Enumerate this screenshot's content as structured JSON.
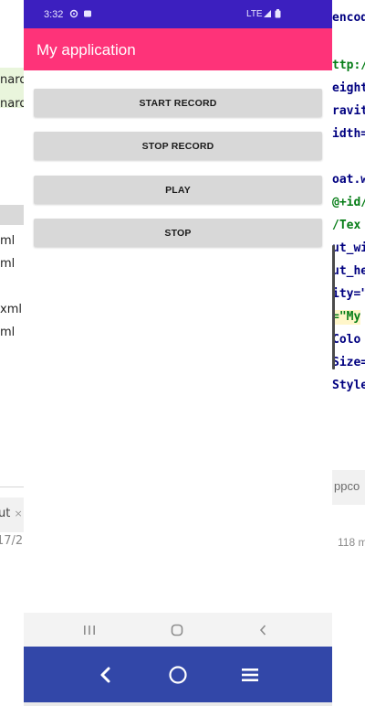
{
  "ide_left": {
    "files": [
      "nard",
      "nard",
      "ml",
      "ml",
      "xml",
      "ml"
    ],
    "tab_label": "ut",
    "tab_close": "×",
    "log_text": "17/2"
  },
  "ide_right": {
    "code_lines": [
      "encod",
      "ttp:/",
      "eight",
      "ravit",
      "idth=",
      "oat.w",
      "@+id/",
      "/Tex",
      "ut_wi",
      "ut_he",
      "ity=\"",
      "=\"My ",
      "Colo",
      "Size=",
      "Style"
    ],
    "tab_label": "ppco",
    "log_text": "118 m"
  },
  "status_bar": {
    "time": "3:32",
    "network": "LTE",
    "icons": [
      "gear-icon",
      "sim-icon",
      "signal-icon",
      "battery-icon"
    ]
  },
  "app_bar": {
    "title": "My application",
    "color": "#fe3379"
  },
  "buttons": {
    "start_record": "START RECORD",
    "stop_record": "STOP RECORD",
    "play": "PLAY",
    "stop": "STOP"
  },
  "nav_light": {
    "recents": "|||",
    "home": "◯",
    "back": "‹"
  },
  "nav_dark": {
    "back": "‹",
    "home": "○",
    "menu": "≡"
  },
  "colors": {
    "status_bar": "#3c1fbf",
    "app_bar": "#fe3379",
    "button": "#d8d8d8",
    "nav_dark": "#3247a8"
  }
}
